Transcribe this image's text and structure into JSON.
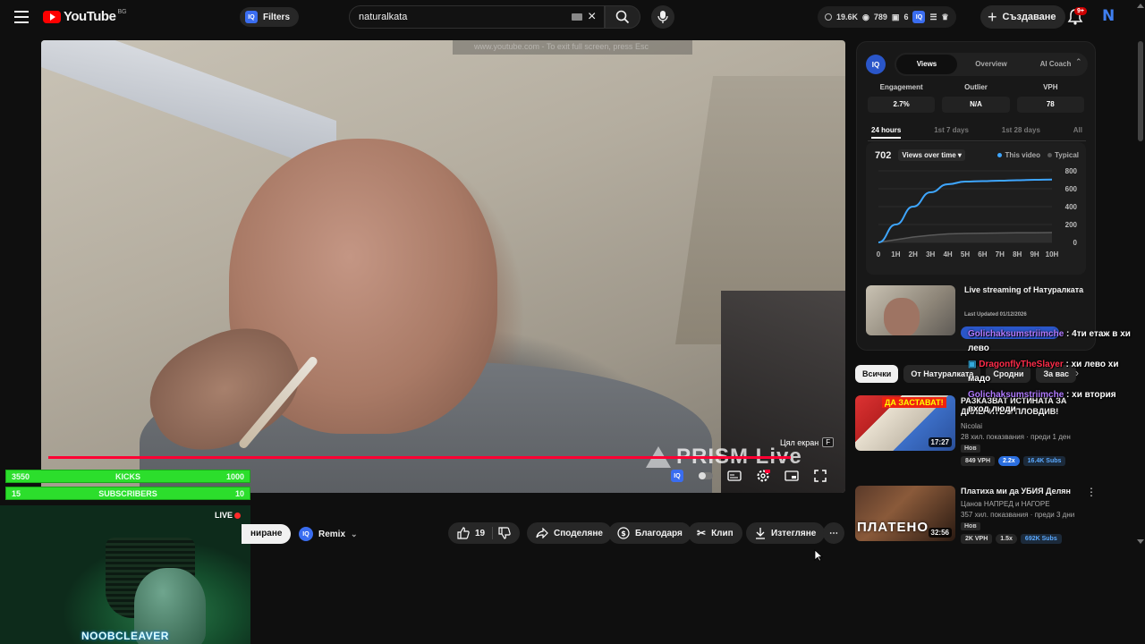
{
  "header": {
    "logo_text": "YouTube",
    "country_code": "BG",
    "filters_label": "Filters",
    "search_value": "naturalkata",
    "stats": [
      "19.6K",
      "789",
      "6"
    ],
    "create_label": "Създаване",
    "notification_count": "9+",
    "avatar_letter": "N"
  },
  "video": {
    "fullscreen_hint": "www.youtube.com - To exit full screen, press",
    "fullscreen_hint_key": "Esc",
    "fullscreen_tooltip": "Цял екран",
    "fullscreen_key": "F",
    "watermark": "PRISM Live",
    "progress_fraction": 0.93
  },
  "stream_overlay": {
    "kicks": {
      "current": "3550",
      "label": "KICKS",
      "goal": "1000"
    },
    "subscribers": {
      "current": "15",
      "label": "SUBSCRIBERS",
      "goal": "10"
    },
    "live_label": "LIVE",
    "streamer_name": "NOOBCLEAVER"
  },
  "actions": {
    "subscribe_partial": "ниране",
    "remix_label": "Remix",
    "like_count": "19",
    "share_label": "Споделяне",
    "thanks_label": "Благодаря",
    "clip_label": "Клип",
    "download_label": "Изтегляне"
  },
  "panel": {
    "iq_label": "IQ",
    "tabs": [
      "Views",
      "Overview",
      "AI Coach"
    ],
    "metrics": [
      {
        "label": "Engagement",
        "value": "2.7%"
      },
      {
        "label": "Outlier",
        "value": "N/A"
      },
      {
        "label": "VPH",
        "value": "78"
      }
    ],
    "ranges": [
      "24 hours",
      "1st 7 days",
      "1st 28 days",
      "All"
    ],
    "chart_total": "702",
    "chart_metric": "Views over time ▾",
    "legend": {
      "this_video": "This video",
      "typical": "Typical"
    },
    "card": {
      "title": "Live streaming of Натуралката",
      "updated": "Last Updated 01/12/2026"
    }
  },
  "chart_data": {
    "type": "line",
    "x": [
      "0",
      "1H",
      "2H",
      "3H",
      "4H",
      "5H",
      "6H",
      "7H",
      "8H",
      "9H",
      "10H"
    ],
    "series": [
      {
        "name": "This video",
        "values": [
          0,
          200,
          400,
          560,
          650,
          680,
          685,
          690,
          695,
          700,
          702
        ]
      },
      {
        "name": "Typical",
        "values": [
          0,
          30,
          60,
          80,
          95,
          100,
          103,
          105,
          107,
          108,
          110
        ]
      }
    ],
    "yticks": [
      "0",
      "200",
      "400",
      "600",
      "800"
    ],
    "ylim": [
      0,
      800
    ],
    "colors": {
      "this_video": "#3ea6ff",
      "typical": "#5a5a5a"
    }
  },
  "chips": [
    "Всички",
    "От Натуралката",
    "Сродни",
    "За вас"
  ],
  "recommendations": [
    {
      "title": "РАЗКАЗВАТ ИСТИНАТА ЗА ДИЛЕРИТЕ В ПЛОВДИВ!",
      "thumb_text": "ДА ЗАСТАВАТ!",
      "duration": "17:27",
      "channel": "Nicolai",
      "meta": "28 хил. показвания · преди 1 ден",
      "badge_new": "Нов",
      "vph": "849 VPH",
      "mult": "2.2x",
      "subs": "16.4K Subs"
    },
    {
      "title": "Платиха ми да УБИЯ Делян",
      "thumb_text": "ПЛАТЕНО",
      "duration": "32:56",
      "channel": "Цанов НАПРЕД и НАГОРЕ",
      "meta": "357 хил. показвания · преди 3 дни",
      "badge_new": "Нов",
      "vph": "2K VPH",
      "mult": "1.5x",
      "subs": "692K Subs"
    }
  ],
  "chat": [
    {
      "user": "Golichaksumstriimche",
      "text": ": 4ти етаж в хи лево"
    },
    {
      "user": "DragonflyTheSlayer",
      "text": ": хи лево хи мадо"
    },
    {
      "user": "Golichaksumstriimche",
      "text": ": хи втория вход люди"
    }
  ]
}
